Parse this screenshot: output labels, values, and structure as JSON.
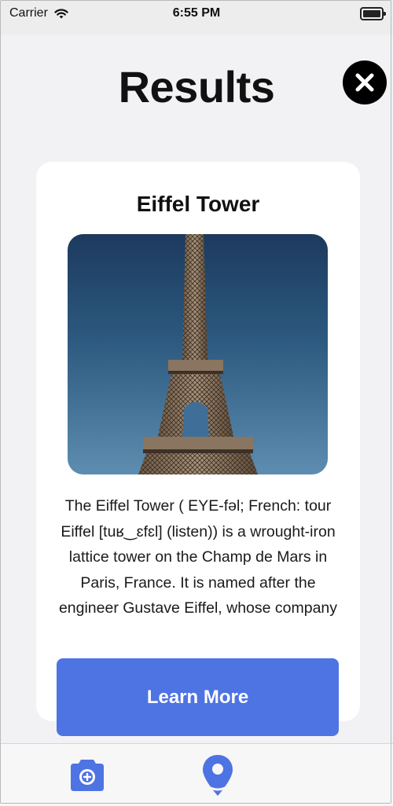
{
  "status_bar": {
    "carrier": "Carrier",
    "time": "6:55 PM"
  },
  "header": {
    "title": "Results",
    "close_icon": "close-icon"
  },
  "result": {
    "title": "Eiffel Tower",
    "image_icon": "eiffel-tower-photo",
    "description": "The Eiffel Tower ( EYE-fəl; French: tour Eiffel [tuʁ‿ɛfɛl] (listen)) is a wrought-iron lattice tower on the Champ de Mars in Paris, France. It is named after the engineer Gustave Eiffel, whose company",
    "learn_more_label": "Learn More"
  },
  "tab_bar": {
    "tabs": [
      {
        "icon": "camera-icon"
      },
      {
        "icon": "map-pin-icon"
      }
    ]
  },
  "colors": {
    "accent": "#4e73e3",
    "background": "#f2f2f5",
    "card": "#ffffff",
    "sky_top": "#1c3a5e",
    "sky_bottom": "#5d8db0"
  }
}
